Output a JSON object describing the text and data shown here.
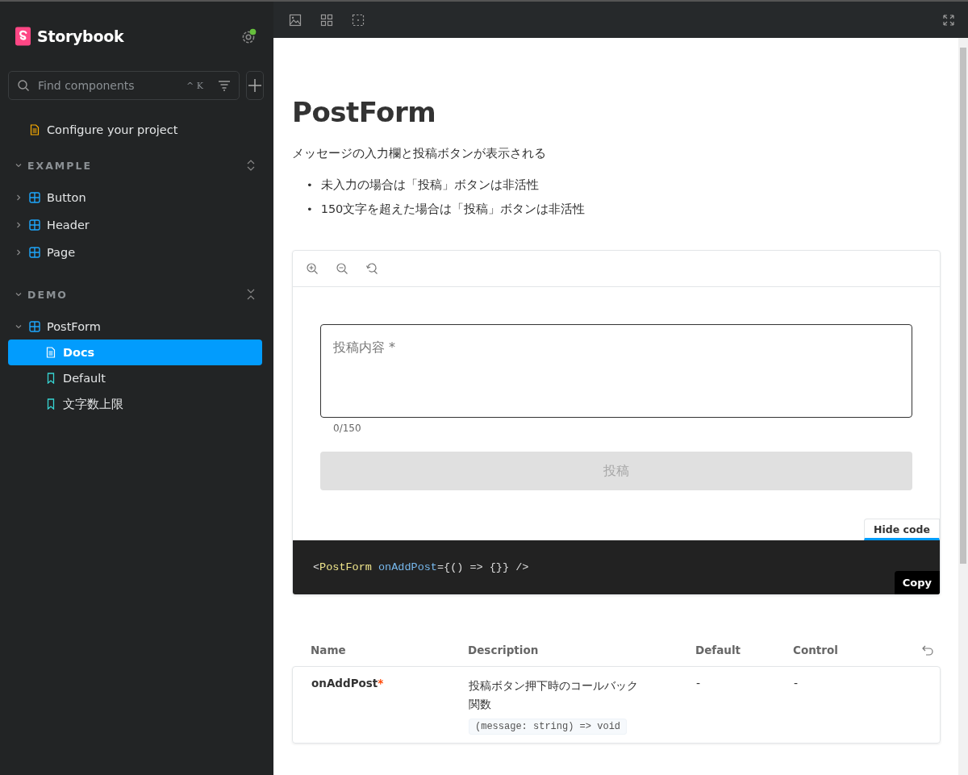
{
  "sidebar": {
    "brand": "Storybook",
    "search": {
      "placeholder": "Find components",
      "shortcut": "^ K"
    },
    "configure": "Configure your project",
    "groups": [
      {
        "label": "EXAMPLE",
        "expanded": true,
        "items": [
          {
            "label": "Button",
            "kind": "component",
            "expanded": false
          },
          {
            "label": "Header",
            "kind": "component",
            "expanded": false
          },
          {
            "label": "Page",
            "kind": "component",
            "expanded": false
          }
        ]
      },
      {
        "label": "DEMO",
        "expanded": true,
        "items": [
          {
            "label": "PostForm",
            "kind": "component",
            "expanded": true,
            "children": [
              {
                "label": "Docs",
                "kind": "docs",
                "selected": true
              },
              {
                "label": "Default",
                "kind": "story",
                "selected": false
              },
              {
                "label": "文字数上限",
                "kind": "story",
                "selected": false
              }
            ]
          }
        ]
      }
    ]
  },
  "docs": {
    "title": "PostForm",
    "description": "メッセージの入力欄と投稿ボタンが表示される",
    "bullets": [
      {
        "marker": "•",
        "text": "未入力の場合は「投稿」ボタンは非活性"
      },
      {
        "marker": "•",
        "text": "150文字を超えた場合は「投稿」ボタンは非活性"
      }
    ],
    "preview": {
      "field": {
        "placeholder": "投稿内容 *"
      },
      "counter": "0/150",
      "submit": {
        "label": "投稿",
        "disabled": true
      },
      "hide_code": "Hide code",
      "code": [
        {
          "kind": "punct",
          "text": "<"
        },
        {
          "kind": "tag",
          "text": "PostForm"
        },
        {
          "kind": "attr",
          "text": " onAddPost"
        },
        {
          "kind": "punct",
          "text": "={() => {}} />"
        }
      ],
      "copy": "Copy"
    },
    "args_table": {
      "columns": [
        "Name",
        "Description",
        "Default",
        "Control"
      ],
      "rows": [
        {
          "name": "onAddPost",
          "required_mark": "*",
          "description": "投稿ボタン押下時のコールバック関数",
          "type": "(message: string) => void",
          "default": "-",
          "control": "-"
        }
      ]
    }
  }
}
